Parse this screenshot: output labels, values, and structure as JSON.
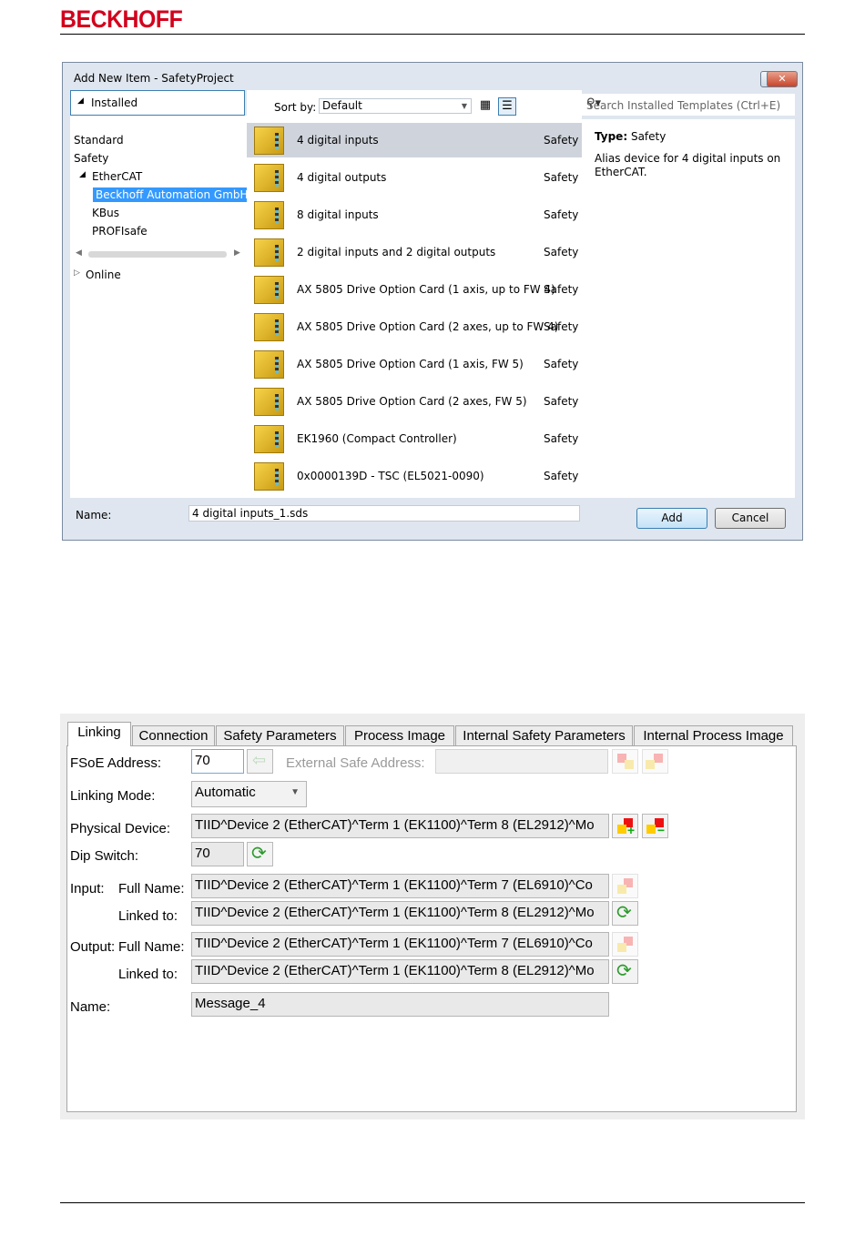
{
  "header": {
    "logo": "BECKHOFF"
  },
  "dialog": {
    "title": "Add New Item - SafetyProject",
    "help_label": "?",
    "close_label": "✕",
    "tree_header": "Installed",
    "tree": {
      "standard": "Standard",
      "safety": "Safety",
      "ethercat": "EtherCAT",
      "beckhoff": "Beckhoff Automation GmbH",
      "kbus": "KBus",
      "profisafe": "PROFIsafe",
      "online": "Online"
    },
    "sort_label": "Sort by:",
    "sort_value": "Default",
    "search_placeholder": "Search Installed Templates (Ctrl+E)",
    "items": [
      {
        "name": "4 digital inputs",
        "category": "Safety"
      },
      {
        "name": "4 digital outputs",
        "category": "Safety"
      },
      {
        "name": "8 digital inputs",
        "category": "Safety"
      },
      {
        "name": "2 digital inputs and 2 digital outputs",
        "category": "Safety"
      },
      {
        "name": "AX 5805 Drive Option Card (1 axis, up to FW 4)",
        "category": "Safety"
      },
      {
        "name": "AX 5805 Drive Option Card (2 axes, up to FW 4)",
        "category": "Safety"
      },
      {
        "name": "AX 5805 Drive Option Card (1 axis, FW 5)",
        "category": "Safety"
      },
      {
        "name": "AX 5805 Drive Option Card (2 axes, FW 5)",
        "category": "Safety"
      },
      {
        "name": "EK1960 (Compact Controller)",
        "category": "Safety"
      },
      {
        "name": "0x0000139D - TSC (EL5021-0090)",
        "category": "Safety"
      }
    ],
    "detail": {
      "type_label": "Type:",
      "type_value": "Safety",
      "description": "Alias device for 4 digital inputs on EtherCAT."
    },
    "name_label": "Name:",
    "name_value": "4 digital inputs_1.sds",
    "add_label": "Add",
    "cancel_label": "Cancel"
  },
  "linking": {
    "tabs": [
      "Linking",
      "Connection",
      "Safety Parameters",
      "Process Image",
      "Internal Safety Parameters",
      "Internal Process Image"
    ],
    "fsoe_label": "FSoE Address:",
    "fsoe_value": "70",
    "ext_label": "External Safe Address:",
    "mode_label": "Linking Mode:",
    "mode_value": "Automatic",
    "phys_label": "Physical Device:",
    "phys_value": "TIID^Device 2 (EtherCAT)^Term 1 (EK1100)^Term 8 (EL2912)^Mo",
    "dip_label": "Dip Switch:",
    "dip_value": "70",
    "input_label": "Input:",
    "full_name_label": "Full Name:",
    "input_full": "TIID^Device 2 (EtherCAT)^Term 1 (EK1100)^Term 7 (EL6910)^Co",
    "linked_label": "Linked to:",
    "input_linked": "TIID^Device 2 (EtherCAT)^Term 1 (EK1100)^Term 8 (EL2912)^Mo",
    "output_label": "Output:",
    "output_full": "TIID^Device 2 (EtherCAT)^Term 1 (EK1100)^Term 7 (EL6910)^Co",
    "output_linked": "TIID^Device 2 (EtherCAT)^Term 1 (EK1100)^Term 8 (EL2912)^Mo",
    "name_label": "Name:",
    "name_value": "Message_4"
  }
}
